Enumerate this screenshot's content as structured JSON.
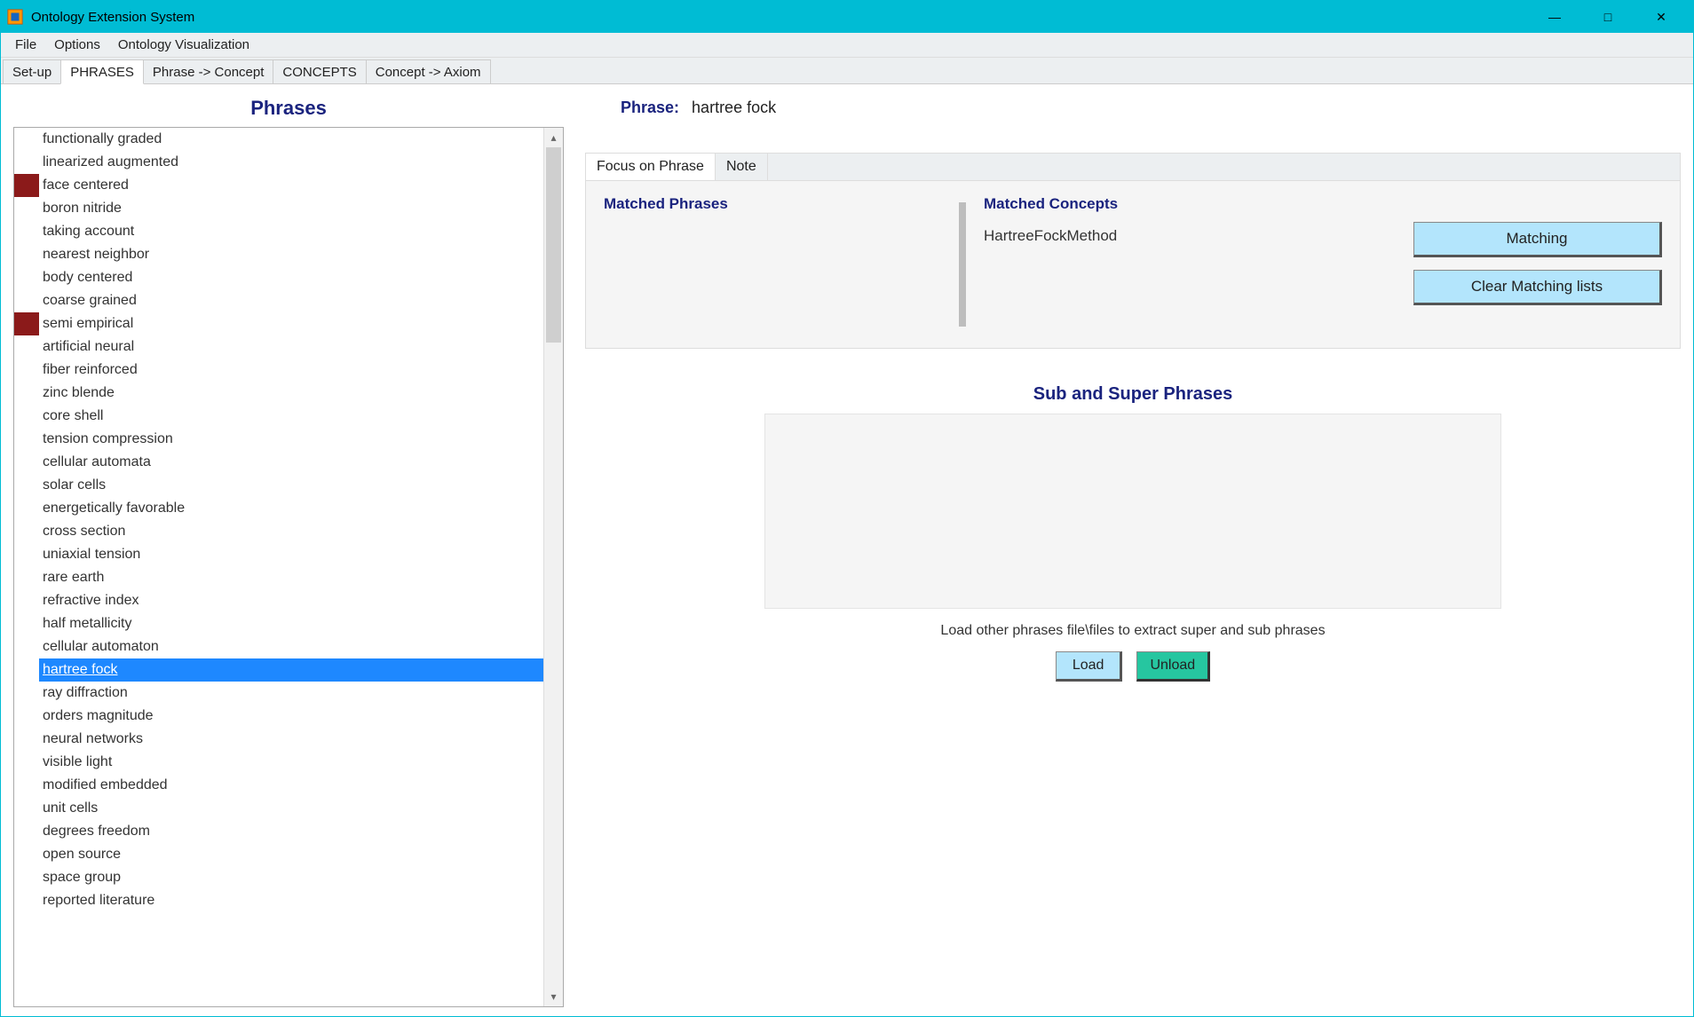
{
  "window": {
    "title": "Ontology Extension System"
  },
  "menu": {
    "items": [
      "File",
      "Options",
      "Ontology Visualization"
    ]
  },
  "tabs": {
    "items": [
      "Set-up",
      "PHRASES",
      "Phrase -> Concept",
      "CONCEPTS",
      "Concept -> Axiom"
    ],
    "active_index": 1
  },
  "left": {
    "header": "Phrases",
    "phrases": [
      {
        "text": "functionally graded",
        "marked": false
      },
      {
        "text": "linearized augmented",
        "marked": false
      },
      {
        "text": "face centered",
        "marked": true
      },
      {
        "text": "boron nitride",
        "marked": false
      },
      {
        "text": "taking account",
        "marked": false
      },
      {
        "text": "nearest neighbor",
        "marked": false
      },
      {
        "text": "body centered",
        "marked": false
      },
      {
        "text": "coarse grained",
        "marked": false
      },
      {
        "text": "semi empirical",
        "marked": true
      },
      {
        "text": "artificial neural",
        "marked": false
      },
      {
        "text": "fiber reinforced",
        "marked": false
      },
      {
        "text": "zinc blende",
        "marked": false
      },
      {
        "text": "core shell",
        "marked": false
      },
      {
        "text": "tension compression",
        "marked": false
      },
      {
        "text": "cellular automata",
        "marked": false
      },
      {
        "text": "solar cells",
        "marked": false
      },
      {
        "text": "energetically favorable",
        "marked": false
      },
      {
        "text": "cross section",
        "marked": false
      },
      {
        "text": "uniaxial tension",
        "marked": false
      },
      {
        "text": "rare earth",
        "marked": false
      },
      {
        "text": "refractive index",
        "marked": false
      },
      {
        "text": "half metallicity",
        "marked": false
      },
      {
        "text": "cellular automaton",
        "marked": false
      },
      {
        "text": "hartree fock",
        "marked": false,
        "selected": true
      },
      {
        "text": "ray diffraction",
        "marked": false
      },
      {
        "text": "orders magnitude",
        "marked": false
      },
      {
        "text": "neural networks",
        "marked": false
      },
      {
        "text": "visible light",
        "marked": false
      },
      {
        "text": "modified embedded",
        "marked": false
      },
      {
        "text": "unit cells",
        "marked": false
      },
      {
        "text": "degrees freedom",
        "marked": false
      },
      {
        "text": "open source",
        "marked": false
      },
      {
        "text": "space group",
        "marked": false
      },
      {
        "text": "reported literature",
        "marked": false
      }
    ]
  },
  "right": {
    "phrase_label": "Phrase:",
    "phrase_value": "hartree fock",
    "subtabs": {
      "items": [
        "Focus on Phrase",
        "Note"
      ],
      "active_index": 0
    },
    "matched_phrases_header": "Matched Phrases",
    "matched_concepts_header": "Matched Concepts",
    "matched_concepts": [
      "HartreeFockMethod"
    ],
    "matching_btn": "Matching",
    "clear_btn": "Clear Matching lists",
    "subsuper_title": "Sub and Super Phrases",
    "hint": "Load other phrases file\\files to extract super and sub phrases",
    "load_btn": "Load",
    "unload_btn": "Unload"
  }
}
